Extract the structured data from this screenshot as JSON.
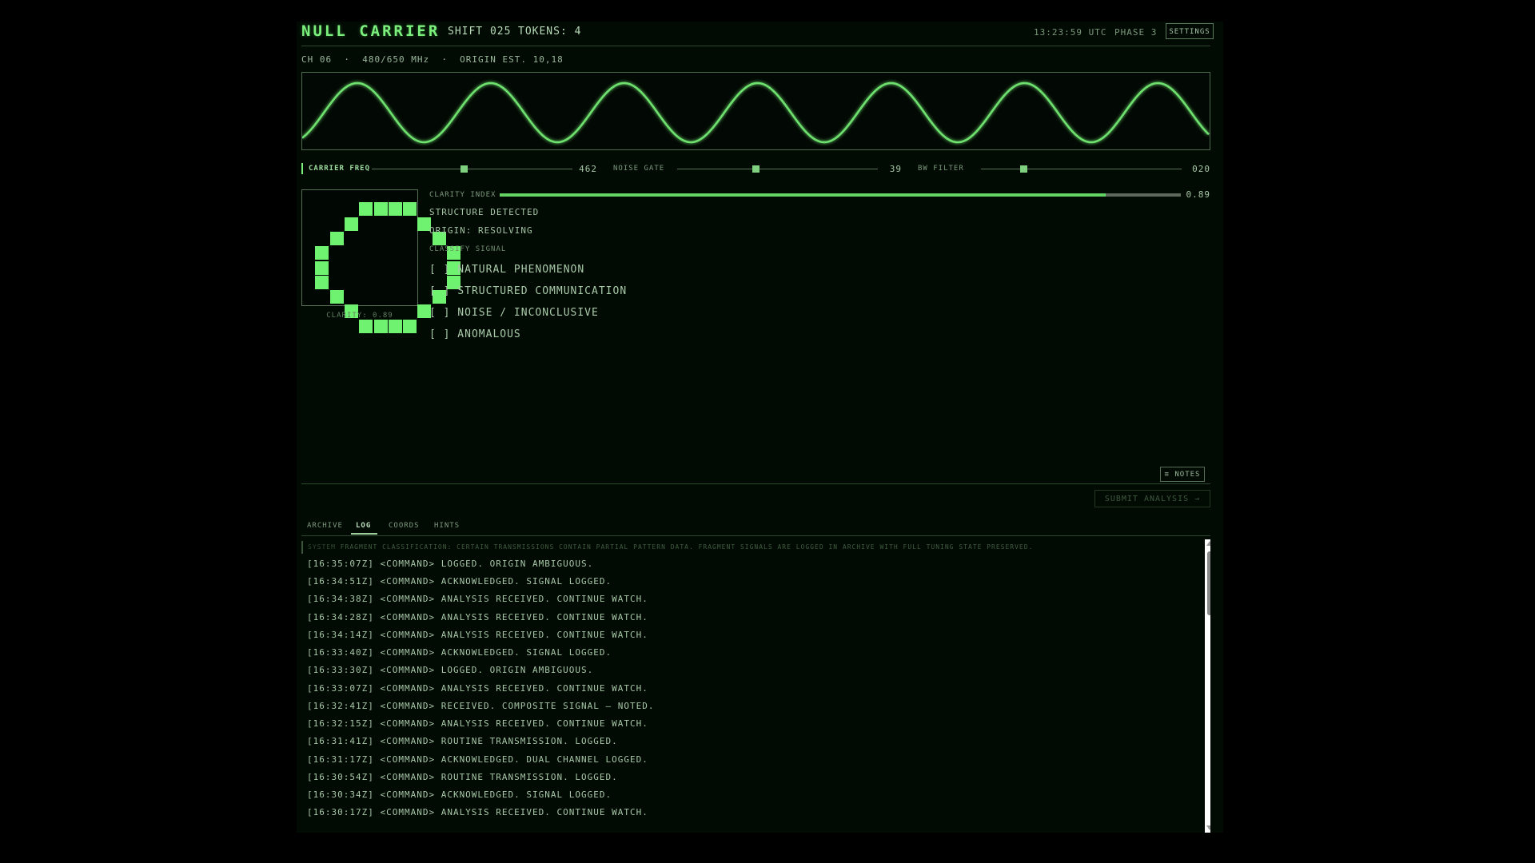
{
  "header": {
    "title": "NULL CARRIER",
    "shift": "SHIFT 025",
    "tokens": "TOKENS: 4",
    "clock": "13:23:59 UTC",
    "phase": "PHASE 3",
    "settings_label": "SETTINGS"
  },
  "channel_line": "CH 06  ·  480/650 MHz  ·  ORIGIN EST. 10,18",
  "oscilloscope": {
    "cycles": 6.8,
    "color": "#6ee06e"
  },
  "sliders": [
    {
      "label": "CARRIER FREQ",
      "value": "462",
      "position": 0.46,
      "active": true
    },
    {
      "label": "NOISE GATE",
      "value": "39",
      "position": 0.39,
      "active": false
    },
    {
      "label": "BW FILTER",
      "value": "020",
      "position": 0.21,
      "active": false
    }
  ],
  "pattern": {
    "rows": [
      "000000000000",
      "000011110000",
      "000100001000",
      "001000000100",
      "010000000010",
      "010000000010",
      "010000000010",
      "001000000100",
      "000100001000",
      "000011110000",
      "000000000000"
    ],
    "caption": "CLARITY: 0.89"
  },
  "clarity": {
    "label": "CLARITY INDEX",
    "value": "0.89",
    "fraction": 0.89
  },
  "status": {
    "line1": "STRUCTURE DETECTED",
    "line2": "ORIGIN: RESOLVING"
  },
  "classify": {
    "label": "CLASSIFY SIGNAL",
    "options": [
      "[ ] NATURAL PHENOMENON",
      "[ ] STRUCTURED COMMUNICATION",
      "[ ] NOISE / INCONCLUSIVE",
      "[ ] ANOMALOUS"
    ]
  },
  "buttons": {
    "notes": "≡ NOTES",
    "submit": "SUBMIT ANALYSIS →"
  },
  "tabs": [
    "ARCHIVE",
    "LOG",
    "COORDS",
    "HINTS"
  ],
  "active_tab": "LOG",
  "log": {
    "system_tag": "SYSTEM",
    "system_text": "FRAGMENT CLASSIFICATION: CERTAIN TRANSMISSIONS CONTAIN PARTIAL PATTERN DATA. FRAGMENT SIGNALS ARE LOGGED IN ARCHIVE WITH FULL TUNING STATE PRESERVED.",
    "entries": [
      "[16:35:07Z] <COMMAND> LOGGED. ORIGIN AMBIGUOUS.",
      "[16:34:51Z] <COMMAND> ACKNOWLEDGED. SIGNAL LOGGED.",
      "[16:34:38Z] <COMMAND> ANALYSIS RECEIVED. CONTINUE WATCH.",
      "[16:34:28Z] <COMMAND> ANALYSIS RECEIVED. CONTINUE WATCH.",
      "[16:34:14Z] <COMMAND> ANALYSIS RECEIVED. CONTINUE WATCH.",
      "[16:33:40Z] <COMMAND> ACKNOWLEDGED. SIGNAL LOGGED.",
      "[16:33:30Z] <COMMAND> LOGGED. ORIGIN AMBIGUOUS.",
      "[16:33:07Z] <COMMAND> ANALYSIS RECEIVED. CONTINUE WATCH.",
      "[16:32:41Z] <COMMAND> RECEIVED. COMPOSITE SIGNAL — NOTED.",
      "[16:32:15Z] <COMMAND> ANALYSIS RECEIVED. CONTINUE WATCH.",
      "[16:31:41Z] <COMMAND> ROUTINE TRANSMISSION. LOGGED.",
      "[16:31:17Z] <COMMAND> ACKNOWLEDGED. DUAL CHANNEL LOGGED.",
      "[16:30:54Z] <COMMAND> ROUTINE TRANSMISSION. LOGGED.",
      "[16:30:34Z] <COMMAND> ACKNOWLEDGED. SIGNAL LOGGED.",
      "[16:30:17Z] <COMMAND> ANALYSIS RECEIVED. CONTINUE WATCH."
    ]
  }
}
